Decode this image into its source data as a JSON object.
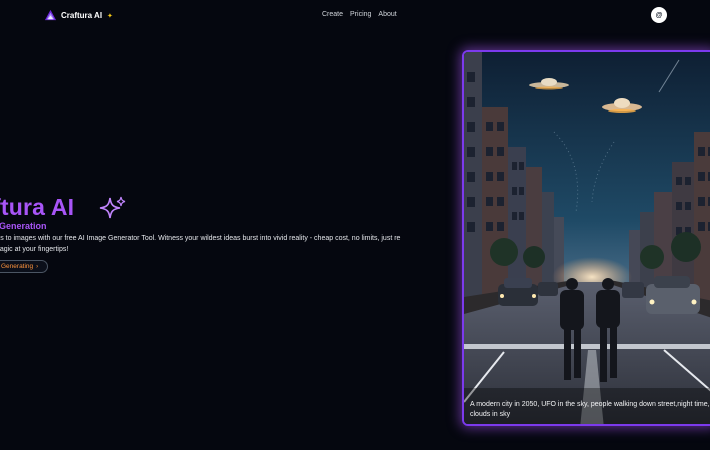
{
  "nav": {
    "brand_name": "Craftura AI",
    "brand_icon": "sparkle-icon",
    "links": [
      "Create",
      "Pricing",
      "About"
    ],
    "profile_initial": "@"
  },
  "hero": {
    "title": "aftura AI",
    "subtitle": "ge Generation",
    "description": "rds to images with our free AI Image Generator Tool. Witness your wildest ideas burst into vivid reality - cheap cost, no limits, just re magic at your fingertips!",
    "cta_label": "Generating",
    "cta_icon": "chevron-right-icon"
  },
  "showcase": {
    "caption": "A modern city in 2050, UFO in the sky, people walking down street,night time, clouds in sky"
  },
  "colors": {
    "background": "#05070f",
    "accent": "#a855f7",
    "cta": "#fb923c"
  }
}
